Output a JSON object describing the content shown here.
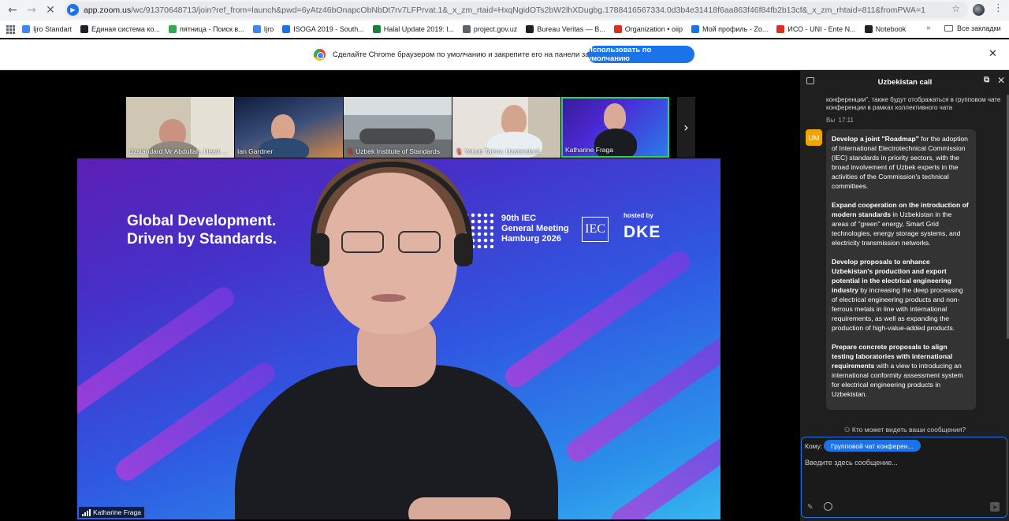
{
  "browser": {
    "url_host": "app.zoom.us",
    "url_path": "/wc/91370648713/join?ref_from=launch&pwd=6yAtz46bOnapcObNbDt7rv7LFPrvat.1&_x_zm_rtaid=HxqNgidOTs2bW2lhXDugbg.1788416567334.0d3b4e31418f6aa863f46f84fb2b13cf&_x_zm_rhtaid=811&fromPWA=1",
    "bookmarks": [
      {
        "label": "Ijro Standart",
        "color": "#4285f4"
      },
      {
        "label": "Единая система ко...",
        "color": "#202124"
      },
      {
        "label": "пятница - Поиск в...",
        "color": "#34a853"
      },
      {
        "label": "Ijro",
        "color": "#4285f4"
      },
      {
        "label": "ISOGA 2019 - South...",
        "color": "#1a73e8"
      },
      {
        "label": "Halal Update 2019: l...",
        "color": "#188038"
      },
      {
        "label": "project.gov.uz",
        "color": "#5f6368"
      },
      {
        "label": "Bureau Veritas — B...",
        "color": "#202124"
      },
      {
        "label": "Organization • oiip",
        "color": "#d93025"
      },
      {
        "label": "Мой профиль - Zo...",
        "color": "#1a73e8"
      },
      {
        "label": "ИСО - UNI - Ente N...",
        "color": "#d93025"
      },
      {
        "label": "Notebook",
        "color": "#202124"
      }
    ],
    "bookmarks_more": "»",
    "all_bookmarks": "Все закладки",
    "infobar_message": "Сделайте Chrome браузером по умолчанию и закрепите его на панели задач.",
    "infobar_button": "Использовать по умолчанию"
  },
  "meeting": {
    "participants": [
      {
        "name": "Uzstandard Mr Abdullah, Head of ...",
        "muted": false
      },
      {
        "name": "Ian Gardner",
        "muted": false
      },
      {
        "name": "Uzbek Institute of Standards",
        "muted": true
      },
      {
        "name": "Yokub Tairov, Uzstandard",
        "muted": true
      },
      {
        "name": "Katharine Fraga",
        "muted": false
      }
    ],
    "next_icon": "chevron-right-icon",
    "active_speaker": "Katharine Fraga",
    "slide": {
      "slogan_line1": "Global Development.",
      "slogan_line2": "Driven by Standards.",
      "event_line1": "90th IEC",
      "event_line2": "General Meeting",
      "event_line3": "Hamburg 2026",
      "iec_logo": "IEC",
      "hosted_by": "hosted by",
      "host": "DKE"
    }
  },
  "chat": {
    "title": "Uzbekistan call",
    "previous_text": "конференции\", также будут отображаться в групповом чате конференции в рамках коллективного чата",
    "sender": "Вы",
    "time": "17:11",
    "avatar_initials": "UM",
    "paragraphs": [
      {
        "bold": "Develop a joint \"Roadmap\"",
        "text": " for the adoption of International Electrotechnical Commission (IEC) standards in priority sectors, with the broad involvement of Uzbek experts in the activities of the Commission's technical committees."
      },
      {
        "bold": "Expand cooperation on the introduction of modern standards",
        "text": " in Uzbekistan in the areas of \"green\" energy, Smart Grid technologies, energy storage systems, and electricity transmission networks."
      },
      {
        "bold": "Develop proposals to enhance Uzbekistan's production and export potential in the electrical engineering industry",
        "text": " by increasing the deep processing of electrical engineering products and non-ferrous metals in line with international requirements, as well as expanding the production of high-value-added products."
      },
      {
        "bold": "Prepare concrete proposals to align testing laboratories with international requirements",
        "text": " with a view to introducing an international conformity assessment system for electrical engineering products in Uzbekistan."
      }
    ],
    "who_can_see": "Кто может видеть ваши сообщения?",
    "to_label": "Кому:",
    "to_value": "Групповой чат конферен...",
    "input_placeholder": "Введите здесь сообщение..."
  }
}
